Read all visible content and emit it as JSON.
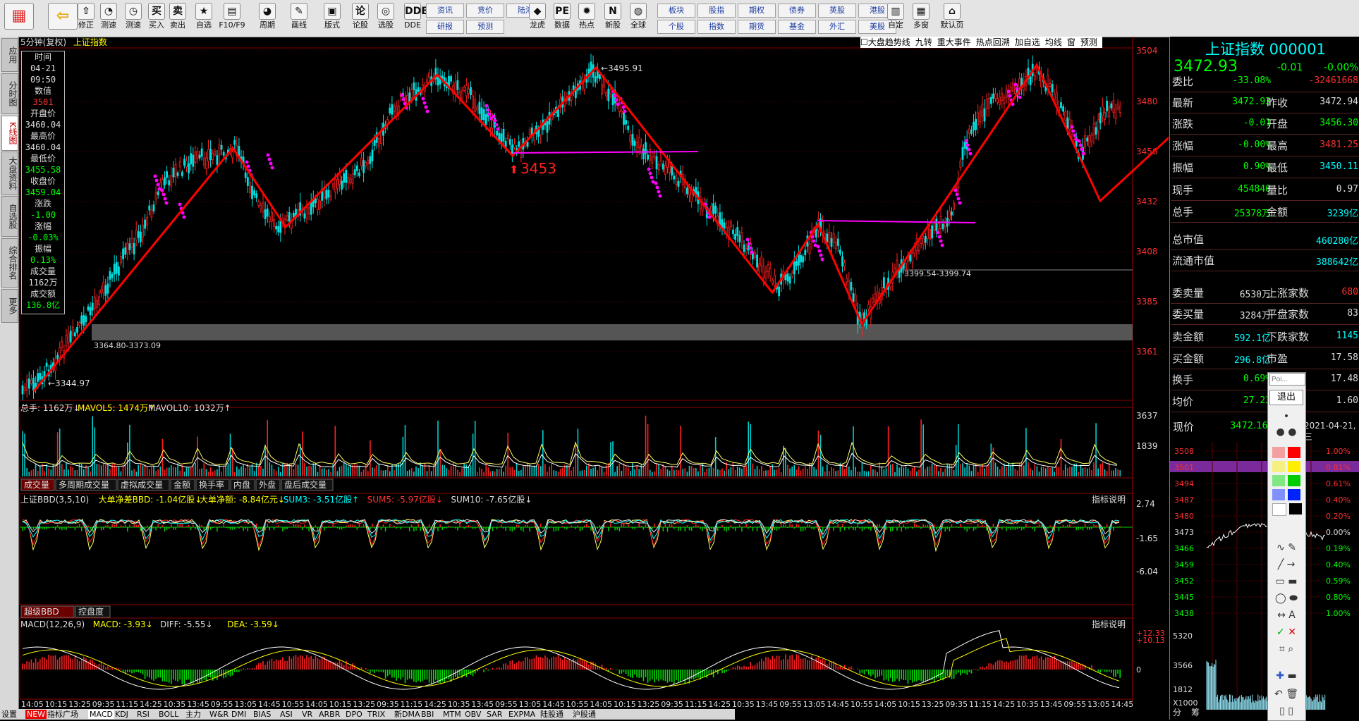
{
  "toolbar": {
    "items": [
      {
        "label": "",
        "icon": "windows-logo-icon"
      },
      {
        "label": "",
        "icon": "back-arrow-icon"
      },
      {
        "label": "修正",
        "icon": "up-arrow-icon"
      },
      {
        "label": "测速",
        "icon": "speedometer-icon"
      },
      {
        "label": "测速",
        "icon": "clock-icon"
      },
      {
        "label": "买入",
        "icon": "buy-icon"
      },
      {
        "label": "卖出",
        "icon": "sell-icon"
      },
      {
        "label": "自选",
        "icon": "star-icon"
      },
      {
        "label": "F10/F9",
        "icon": "f10-icon"
      },
      {
        "label": "周期",
        "icon": "period-icon"
      },
      {
        "label": "画线",
        "icon": "pen-icon"
      },
      {
        "label": "版式",
        "icon": "layout-icon"
      },
      {
        "label": "论股",
        "icon": "discuss-icon"
      },
      {
        "label": "选股",
        "icon": "select-stock-icon"
      },
      {
        "label": "DDE",
        "icon": "dde-icon"
      }
    ],
    "quick": [
      {
        "top": "资讯",
        "bottom": "研报"
      },
      {
        "top": "竞价",
        "bottom": "预测"
      },
      {
        "top": "陆港",
        "bottom": ""
      }
    ],
    "items2": [
      {
        "label": "龙虎",
        "icon": "tiger-icon"
      },
      {
        "label": "数据",
        "icon": "pe-icon"
      },
      {
        "label": "热点",
        "icon": "hot-icon"
      },
      {
        "label": "新股",
        "icon": "new-stock-icon"
      },
      {
        "label": "全球",
        "icon": "globe-icon"
      }
    ],
    "quick2": [
      {
        "top": "板块",
        "bottom": "个股"
      },
      {
        "top": "股指",
        "bottom": "指数"
      },
      {
        "top": "期权",
        "bottom": "期货"
      },
      {
        "top": "债券",
        "bottom": "基金"
      },
      {
        "top": "英股",
        "bottom": "外汇"
      },
      {
        "top": "港股",
        "bottom": "美股"
      }
    ],
    "items3": [
      {
        "label": "自定",
        "icon": "custom-icon"
      },
      {
        "label": "多窗",
        "icon": "multi-window-icon"
      },
      {
        "label": "默认页",
        "icon": "home-icon"
      }
    ]
  },
  "left_tabs": [
    "应用",
    "分时图",
    "K线图",
    "大盘资料",
    "自选股",
    "综合排名",
    "更多"
  ],
  "chart_header": {
    "period": "5分钟(复权)",
    "name": "上证指数"
  },
  "header_tools": [
    "大盘趋势线",
    "九转",
    "重大事件",
    "热点回溯",
    "加自选",
    "均线",
    "窗",
    "预测"
  ],
  "infobox": [
    {
      "k": "时间",
      "v": "04-21"
    },
    {
      "k": "",
      "v": "09:50"
    },
    {
      "k": "数值",
      "v": "3501"
    },
    {
      "k": "开盘价",
      "v": "3460.04"
    },
    {
      "k": "最高价",
      "v": "3460.04"
    },
    {
      "k": "最低价",
      "v": "3455.58"
    },
    {
      "k": "收盘价",
      "v": "3459.04"
    },
    {
      "k": "涨跌",
      "v": "-1.00"
    },
    {
      "k": "涨幅",
      "v": "-0.03%"
    },
    {
      "k": "振幅",
      "v": "0.13%"
    },
    {
      "k": "成交量",
      "v": "1162万"
    },
    {
      "k": "成交额",
      "v": "136.8亿"
    }
  ],
  "price_axis": [
    "3504",
    "3480",
    "3456",
    "3432",
    "3408",
    "3385",
    "3361"
  ],
  "annotations": {
    "high_label": "3495.91",
    "low_label": "3344.97",
    "big_label": "3453",
    "band1": "3364.80-3373.09",
    "band2": "3399.54-3399.74"
  },
  "volume_panel": {
    "legend": "总手: 1162万↓ MAVOL5: 1474万↑ MAVOL10: 1032万↑",
    "legend_parts": [
      "总手: 1162万↓",
      "MAVOL5: 1474万↑",
      "MAVOL10: 1032万↑"
    ],
    "axis": [
      "3637",
      "1839"
    ],
    "tabs": [
      "成交量",
      "多周期成交量",
      "虚拟成交量",
      "金额",
      "换手率",
      "内盘",
      "外盘",
      "盘后成交量"
    ]
  },
  "bbd_panel": {
    "legend_parts": [
      "上证BBD(3,5,10)",
      "大单净差BBD: -1.04亿股↓",
      "大单净额: -8.84亿元↓",
      "SUM3: -3.51亿股↑",
      "SUM5: -5.97亿股↓",
      "SUM10: -7.65亿股↓"
    ],
    "axis": [
      "2.74",
      "-1.65",
      "-6.04"
    ],
    "explain": "指标说明",
    "tabs": [
      "超级BBD",
      "控盘度"
    ]
  },
  "macd_panel": {
    "legend_parts": [
      "MACD(12,26,9)",
      "MACD: -3.93↓",
      "DIFF: -5.55↓",
      "DEA: -3.59↓"
    ],
    "axis": [
      "+12.33",
      "+10.13",
      "0"
    ],
    "explain": "指标说明"
  },
  "time_axis": [
    "14:05",
    "10:15",
    "13:25",
    "09:35",
    "11:15",
    "14:25",
    "10:35",
    "13:45",
    "09:55",
    "13:05",
    "14:45",
    "10:55",
    "14:05",
    "10:15",
    "13:25",
    "09:35",
    "11:15",
    "14:25",
    "10:35",
    "13:45",
    "09:55",
    "13:05",
    "14:45",
    "10:55",
    "14:05",
    "10:15",
    "13:25",
    "09:35",
    "11:15",
    "14:25",
    "10:35",
    "13:45",
    "09:55",
    "13:05",
    "14:45",
    "10:55",
    "14:05",
    "10:15",
    "13:25",
    "09:35",
    "11:15",
    "14:25",
    "10:35",
    "13:45",
    "09:55",
    "13:05",
    "14:45"
  ],
  "bottom_tabs": [
    "设置",
    "NEW",
    "指标广场",
    "MACD",
    "KDJ",
    "RSI",
    "BOLL",
    "主力",
    "W&R",
    "DMI",
    "BIAS",
    "ASI",
    "VR",
    "ARBR",
    "DPO",
    "TRIX",
    "新DMA",
    "BBI",
    "MTM",
    "OBV",
    "SAR",
    "EXPMA",
    "陆股通",
    "沪股通"
  ],
  "right_panel": {
    "title": "上证指数 000001",
    "price": "3472.93",
    "change": "-0.01",
    "pct": "-0.00%",
    "rows": [
      {
        "k": "委比",
        "v1": "-33.08%",
        "k2": "",
        "v2": "-32461668"
      },
      {
        "k": "最新",
        "v1": "3472.93",
        "k2": "昨收",
        "v2": "3472.94"
      },
      {
        "k": "涨跌",
        "v1": "-0.01",
        "k2": "开盘",
        "v2": "3456.30"
      },
      {
        "k": "涨幅",
        "v1": "-0.00%",
        "k2": "最高",
        "v2": "3481.25"
      },
      {
        "k": "振幅",
        "v1": "0.90%",
        "k2": "最低",
        "v2": "3450.11"
      },
      {
        "k": "现手",
        "v1": "454840",
        "k2": "量比",
        "v2": "0.97"
      },
      {
        "k": "总手",
        "v1": "25378万",
        "k2": "金额",
        "v2": "3239亿"
      },
      {
        "k": "总市值",
        "v1": "",
        "k2": "",
        "v2": "460280亿"
      },
      {
        "k": "流通市值",
        "v1": "",
        "k2": "",
        "v2": "388642亿"
      },
      {
        "k": "委卖量",
        "v1": "6530万",
        "k2": "上涨家数",
        "v2": "680"
      },
      {
        "k": "委买量",
        "v1": "3284万",
        "k2": "平盘家数",
        "v2": "83"
      },
      {
        "k": "卖金额",
        "v1": "592.1亿",
        "k2": "下跌家数",
        "v2": "1145"
      },
      {
        "k": "买金额",
        "v1": "296.8亿",
        "k2": "市盈",
        "v2": "17.58"
      },
      {
        "k": "换手",
        "v1": "0.69%",
        "k2": "",
        "v2": "17.48"
      },
      {
        "k": "均价",
        "v1": "27.23",
        "k2": "",
        "v2": "1.60"
      }
    ],
    "now_label": "现价",
    "now_value": "3472.16",
    "date": "2021-04-21,三",
    "mini_axis_left": [
      "3508",
      "3501",
      "3494",
      "3487",
      "3480",
      "3473",
      "3466",
      "3459",
      "3452",
      "3445",
      "3438"
    ],
    "mini_axis_right": [
      "1.00%",
      "0.81%",
      "0.61%",
      "0.40%",
      "0.20%",
      "0.00%",
      "0.19%",
      "0.40%",
      "0.59%",
      "0.80%",
      "1.00%"
    ],
    "vol_axis": [
      "5320",
      "3566",
      "1812",
      "X1000"
    ],
    "tabs": [
      "分",
      "筹"
    ]
  },
  "palette": {
    "input_placeholder": "Poi...",
    "exit": "退出"
  }
}
